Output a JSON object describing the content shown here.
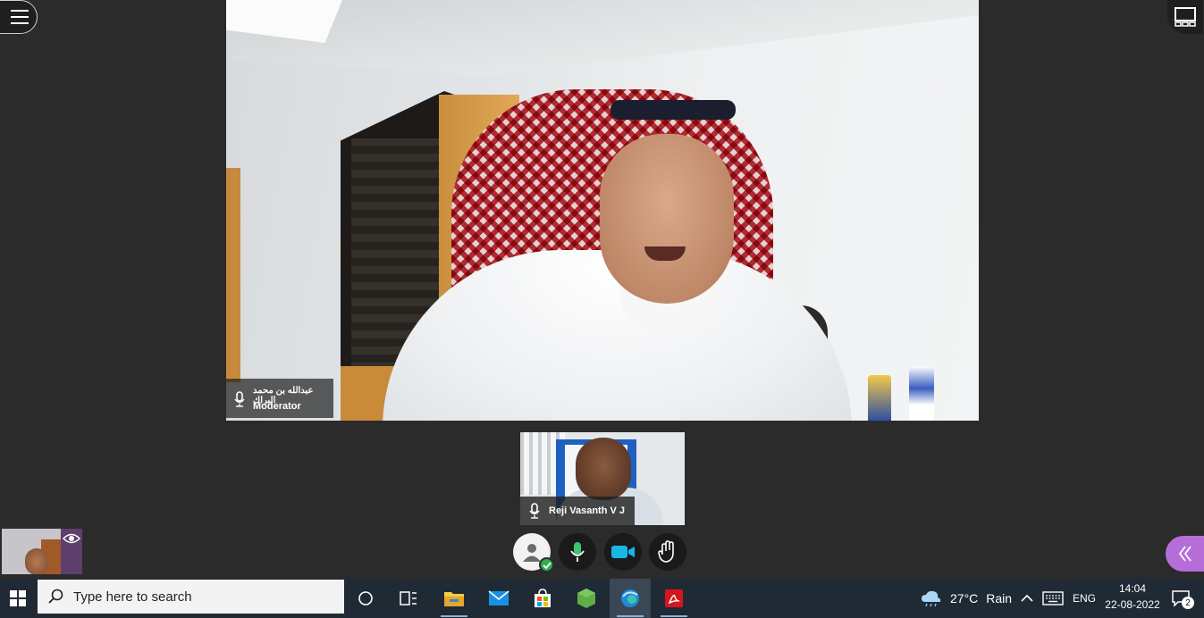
{
  "meeting": {
    "main_participant": {
      "name": "عبدالله بن محمد البراك",
      "role": "Moderator"
    },
    "second_participant": {
      "name": "Reji Vasanth V J"
    }
  },
  "taskbar": {
    "search_placeholder": "Type here to search",
    "weather": {
      "temp": "27°C",
      "condition": "Rain"
    },
    "language": "ENG",
    "time": "14:04",
    "date": "22-08-2022",
    "notification_count": "2"
  },
  "colors": {
    "accent_purple": "#b56ed8",
    "status_green": "#2fae4e",
    "taskbar_bg": "#1f2a35"
  },
  "icons": [
    "menu-icon",
    "layout-icon",
    "mic-icon",
    "eye-icon",
    "user-icon",
    "microphone-icon",
    "camera-icon",
    "raise-hand-icon",
    "chevron-left-icon",
    "windows-start-icon",
    "search-icon",
    "task-view-icon",
    "widgets-icon",
    "file-explorer-icon",
    "mail-icon",
    "store-icon",
    "app-icon",
    "edge-icon",
    "pdf-icon",
    "weather-icon",
    "chevron-up-icon",
    "keyboard-icon",
    "notification-icon"
  ]
}
